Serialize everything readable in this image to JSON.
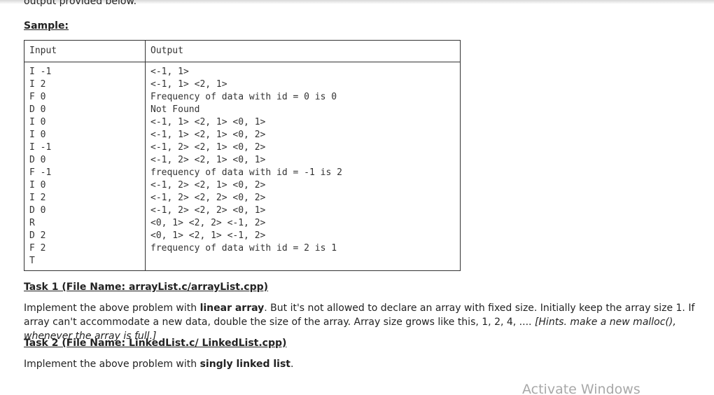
{
  "intro_cut_text": "output provided below.",
  "sample_heading": "Sample:",
  "table": {
    "headers": [
      "Input",
      "Output"
    ],
    "input_lines": [
      "I -1",
      "I 2",
      "F 0",
      "D 0",
      "I 0",
      "I 0",
      "I -1",
      "D 0",
      "F -1",
      "I 0",
      "I 2",
      "D 0",
      "R",
      "D 2",
      "F 2",
      "T"
    ],
    "output_lines": [
      "<-1, 1>",
      "<-1, 1> <2, 1>",
      "Frequency of data with id = 0 is 0",
      "Not Found",
      "<-1, 1> <2, 1> <0, 1>",
      "<-1, 1> <2, 1> <0, 2>",
      "<-1, 2> <2, 1> <0, 2>",
      "<-1, 2> <2, 1> <0, 1>",
      "frequency of data with id = -1 is 2",
      "<-1, 2> <2, 1> <0, 2>",
      "<-1, 2> <2, 2> <0, 2>",
      "<-1, 2> <2, 2> <0, 1>",
      "<0, 1> <2, 2> <-1, 2>",
      "<0, 1> <2, 1> <-1, 2>",
      "frequency of data with id = 2 is 1"
    ]
  },
  "task1": {
    "title": "Task 1 (File Name: arrayList.c/arrayList.cpp)",
    "p_pre": "Implement the above problem with ",
    "p_bold": "linear array",
    "p_mid": ". But it's not allowed to declare an array with fixed size. Initially keep the array size 1. If array can't accommodate a new data, double the size of the array. Array size grows like this, 1, 2, 4, .... ",
    "p_italic": "[Hints. make a new malloc(), whenever the array is full.]"
  },
  "task2": {
    "title": "Task 2 (File Name: LinkedList.c/ LinkedList.cpp)",
    "p_pre": "Implement the above problem with ",
    "p_bold": "singly linked list",
    "p_post": "."
  },
  "watermark": "Activate Windows"
}
